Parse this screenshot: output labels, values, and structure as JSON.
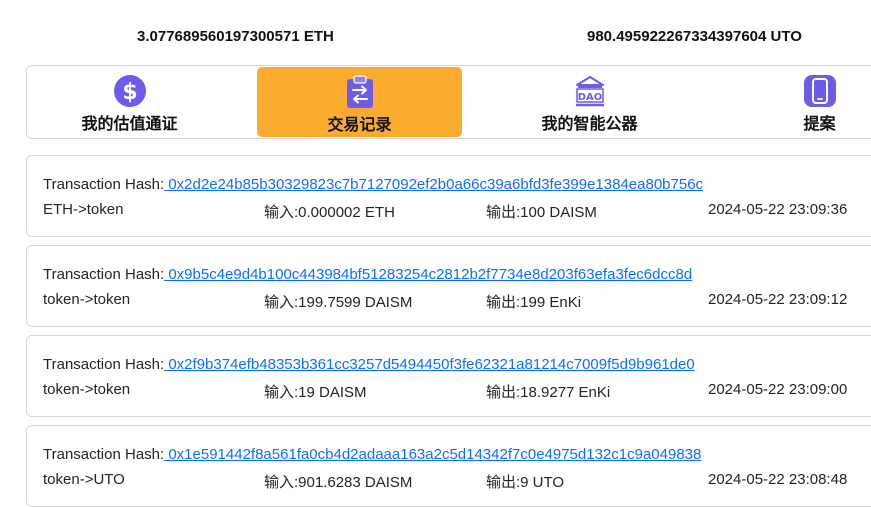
{
  "balances": {
    "eth": "3.077689560197300571 ETH",
    "uto": "980.495922267334397604 UTO"
  },
  "tabs": [
    {
      "label": "我的估值通证",
      "icon": "dollar-coin-icon",
      "active": false
    },
    {
      "label": "交易记录",
      "icon": "exchange-clipboard-icon",
      "active": true
    },
    {
      "label": "我的智能公器",
      "icon": "dao-building-icon",
      "active": false
    },
    {
      "label": "提案",
      "icon": "mobile-phone-icon",
      "active": false
    }
  ],
  "colors": {
    "active_tab": "#fbab2d",
    "link": "#0d6efd",
    "icon_purple": "#6c5ce7"
  },
  "transactions": [
    {
      "hash_label": "Transaction Hash:",
      "hash": " 0x2d2e24b85b30329823c7b7127092ef2b0a66c39a6bfd3fe399e1384ea80b756c",
      "type": "ETH->token",
      "input": "输入:0.000002 ETH",
      "output": "输出:100 DAISM",
      "time": "2024-05-22 23:09:36"
    },
    {
      "hash_label": "Transaction Hash:",
      "hash": " 0x9b5c4e9d4b100c443984bf51283254c2812b2f7734e8d203f63efa3fec6dcc8d",
      "type": "token->token",
      "input": "输入:199.7599 DAISM",
      "output": "输出:199 EnKi",
      "time": "2024-05-22 23:09:12"
    },
    {
      "hash_label": "Transaction Hash:",
      "hash": " 0x2f9b374efb48353b361cc3257d5494450f3fe62321a81214c7009f5d9b961de0",
      "type": "token->token",
      "input": "输入:19 DAISM",
      "output": "输出:18.9277 EnKi",
      "time": "2024-05-22 23:09:00"
    },
    {
      "hash_label": "Transaction Hash:",
      "hash": " 0x1e591442f8a561fa0cb4d2adaaa163a2c5d14342f7c0e4975d132c1c9a049838",
      "type": "token->UTO",
      "input": "输入:901.6283 DAISM",
      "output": "输出:9 UTO",
      "time": "2024-05-22 23:08:48"
    }
  ]
}
